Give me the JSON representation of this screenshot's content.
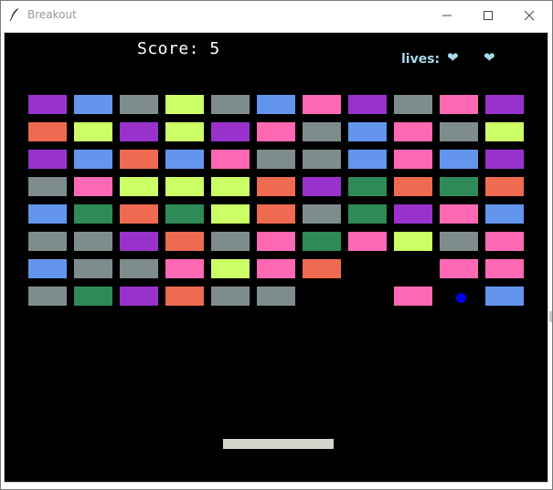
{
  "window": {
    "title": "Breakout",
    "minimize_glyph": "—",
    "maximize_glyph": "☐",
    "close_glyph": "✕"
  },
  "hud": {
    "score_text": "Score: 5",
    "lives_label": "lives:",
    "heart_glyph": "❤",
    "lives": 2,
    "lives_color": "#a8d8ec"
  },
  "colors": {
    "P": "#9932cc",
    "B": "#6495ed",
    "G": "#7f8c8d",
    "L": "#ccff66",
    "K": "#ff69b4",
    "O": "#ee6a50",
    "S": "#2e8b57"
  },
  "bricks": [
    [
      "P",
      "B",
      "G",
      "L",
      "G",
      "B",
      "K",
      "P",
      "G",
      "K",
      "P"
    ],
    [
      "O",
      "L",
      "P",
      "L",
      "P",
      "K",
      "G",
      "B",
      "K",
      "G",
      "L"
    ],
    [
      "P",
      "B",
      "O",
      "B",
      "K",
      "G",
      "G",
      "B",
      "K",
      "B",
      "P"
    ],
    [
      "G",
      "K",
      "L",
      "L",
      "L",
      "O",
      "P",
      "S",
      "O",
      "S",
      "O"
    ],
    [
      "B",
      "S",
      "O",
      "S",
      "L",
      "O",
      "G",
      "S",
      "P",
      "K",
      "B"
    ],
    [
      "G",
      "G",
      "P",
      "O",
      "G",
      "K",
      "S",
      "K",
      "L",
      "G",
      "K"
    ],
    [
      "B",
      "G",
      "G",
      "K",
      "L",
      "K",
      "O",
      null,
      null,
      "K",
      "K"
    ],
    [
      "G",
      "S",
      "P",
      "O",
      "G",
      "G",
      null,
      null,
      "K",
      null,
      "B"
    ]
  ],
  "ball": {
    "color": "#0000ee"
  },
  "paddle": {
    "color": "#d4d4cc"
  }
}
